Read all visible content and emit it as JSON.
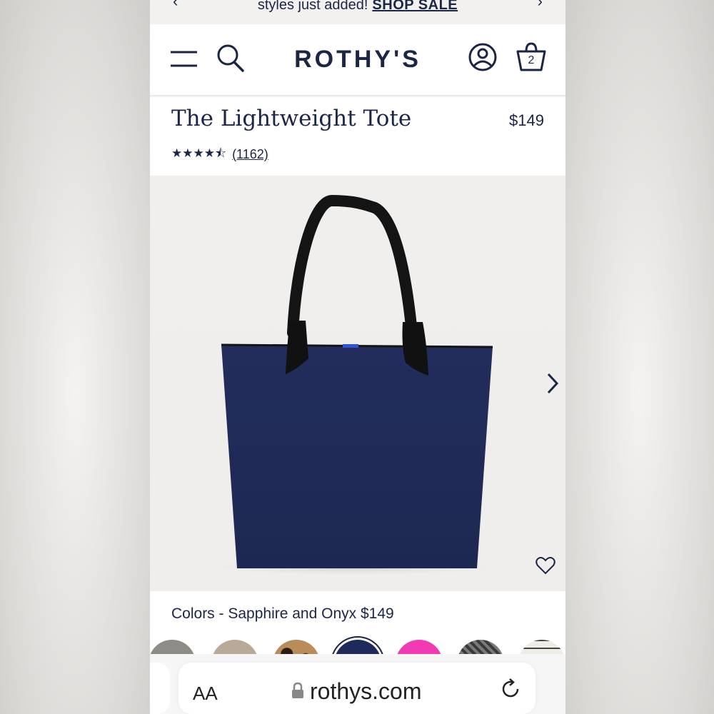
{
  "promo": {
    "text": "styles just added!",
    "link": "SHOP SALE",
    "prev_arrow": "‹",
    "next_arrow": "›"
  },
  "header": {
    "logo": "ROTHY'S",
    "cart_count": "2",
    "icons": [
      "menu-icon",
      "search-icon",
      "account-icon",
      "cart-icon"
    ]
  },
  "product": {
    "title": "The Lightweight Tote",
    "price": "$149",
    "stars": "★★★★⯪",
    "rating": 4.5,
    "reviews": "(1162)"
  },
  "gallery": {
    "next_icon": "chevron-right-icon",
    "favorite_icon": "heart-icon"
  },
  "colors": {
    "label": "Colors - Sapphire and Onyx $149",
    "swatches": [
      {
        "name": "grey",
        "color": "#8f8c88"
      },
      {
        "name": "taupe",
        "color": "#b8aa96"
      },
      {
        "name": "leopard",
        "color": "#7a5a3c"
      },
      {
        "name": "sapphire",
        "color": "#1e2a5a"
      },
      {
        "name": "pink",
        "color": "#f23ab5"
      },
      {
        "name": "black-pattern",
        "color": "#3a3a3a"
      },
      {
        "name": "grid",
        "color": "#efece6"
      }
    ]
  },
  "browser": {
    "aa_label": "AA",
    "url": "rothys.com"
  },
  "colors_theme": {
    "navy": "#1b2545",
    "bag": "#1f2a57"
  }
}
